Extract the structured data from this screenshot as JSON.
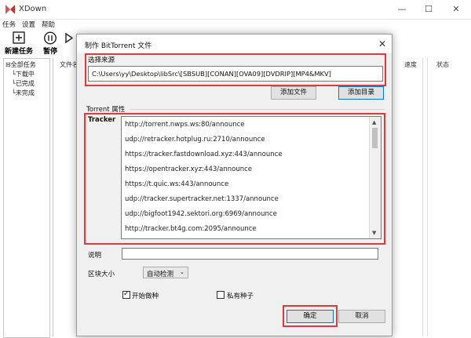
{
  "app": {
    "title": "XDown",
    "menu": [
      "任务",
      "设置",
      "帮助"
    ],
    "toolbar": [
      {
        "label": "新建任务",
        "icon": "plus-icon"
      },
      {
        "label": "暂停",
        "icon": "pause-icon"
      },
      {
        "label": "",
        "icon": "start-icon"
      }
    ],
    "tree": {
      "root": "全部任务",
      "children": [
        "下载中",
        "已完成",
        "未完成"
      ]
    },
    "list_columns": [
      "文件名",
      "速度",
      "状态"
    ]
  },
  "dialog": {
    "title": "制作 BitTorrent 文件",
    "source_label": "选择来源",
    "source_path": "C:\\Users\\yy\\Desktop\\libSrc\\[SBSUB][CONAN][OVA09][DVDRIP][MP4&MKV]",
    "add_file_button": "添加文件",
    "add_folder_button": "添加目录",
    "torrent_props_label": "Torrent 属性",
    "tracker_label": "Tracker",
    "trackers": [
      "http://torrent.nwps.ws:80/announce",
      "udp://retracker.hotplug.ru:2710/announce",
      "https://tracker.fastdownload.xyz:443/announce",
      "https://opentracker.xyz:443/announce",
      "https://t.quic.ws:443/announce",
      "udp://tracker.supertracker.net:1337/announce",
      "udp://bigfoot1942.sektori.org:6969/announce",
      "http://tracker.bt4g.com:2095/announce"
    ],
    "comment_label": "说明",
    "comment_value": "",
    "block_size_label": "区块大小",
    "block_size_value": "自动检测",
    "start_seeding_label": "开始做种",
    "start_seeding_checked": true,
    "private_seed_label": "私有种子",
    "private_seed_checked": false,
    "ok_button": "确定",
    "cancel_button": "取消"
  },
  "colors": {
    "highlight_border": "#e0393e",
    "focus_border": "#0078d7"
  }
}
